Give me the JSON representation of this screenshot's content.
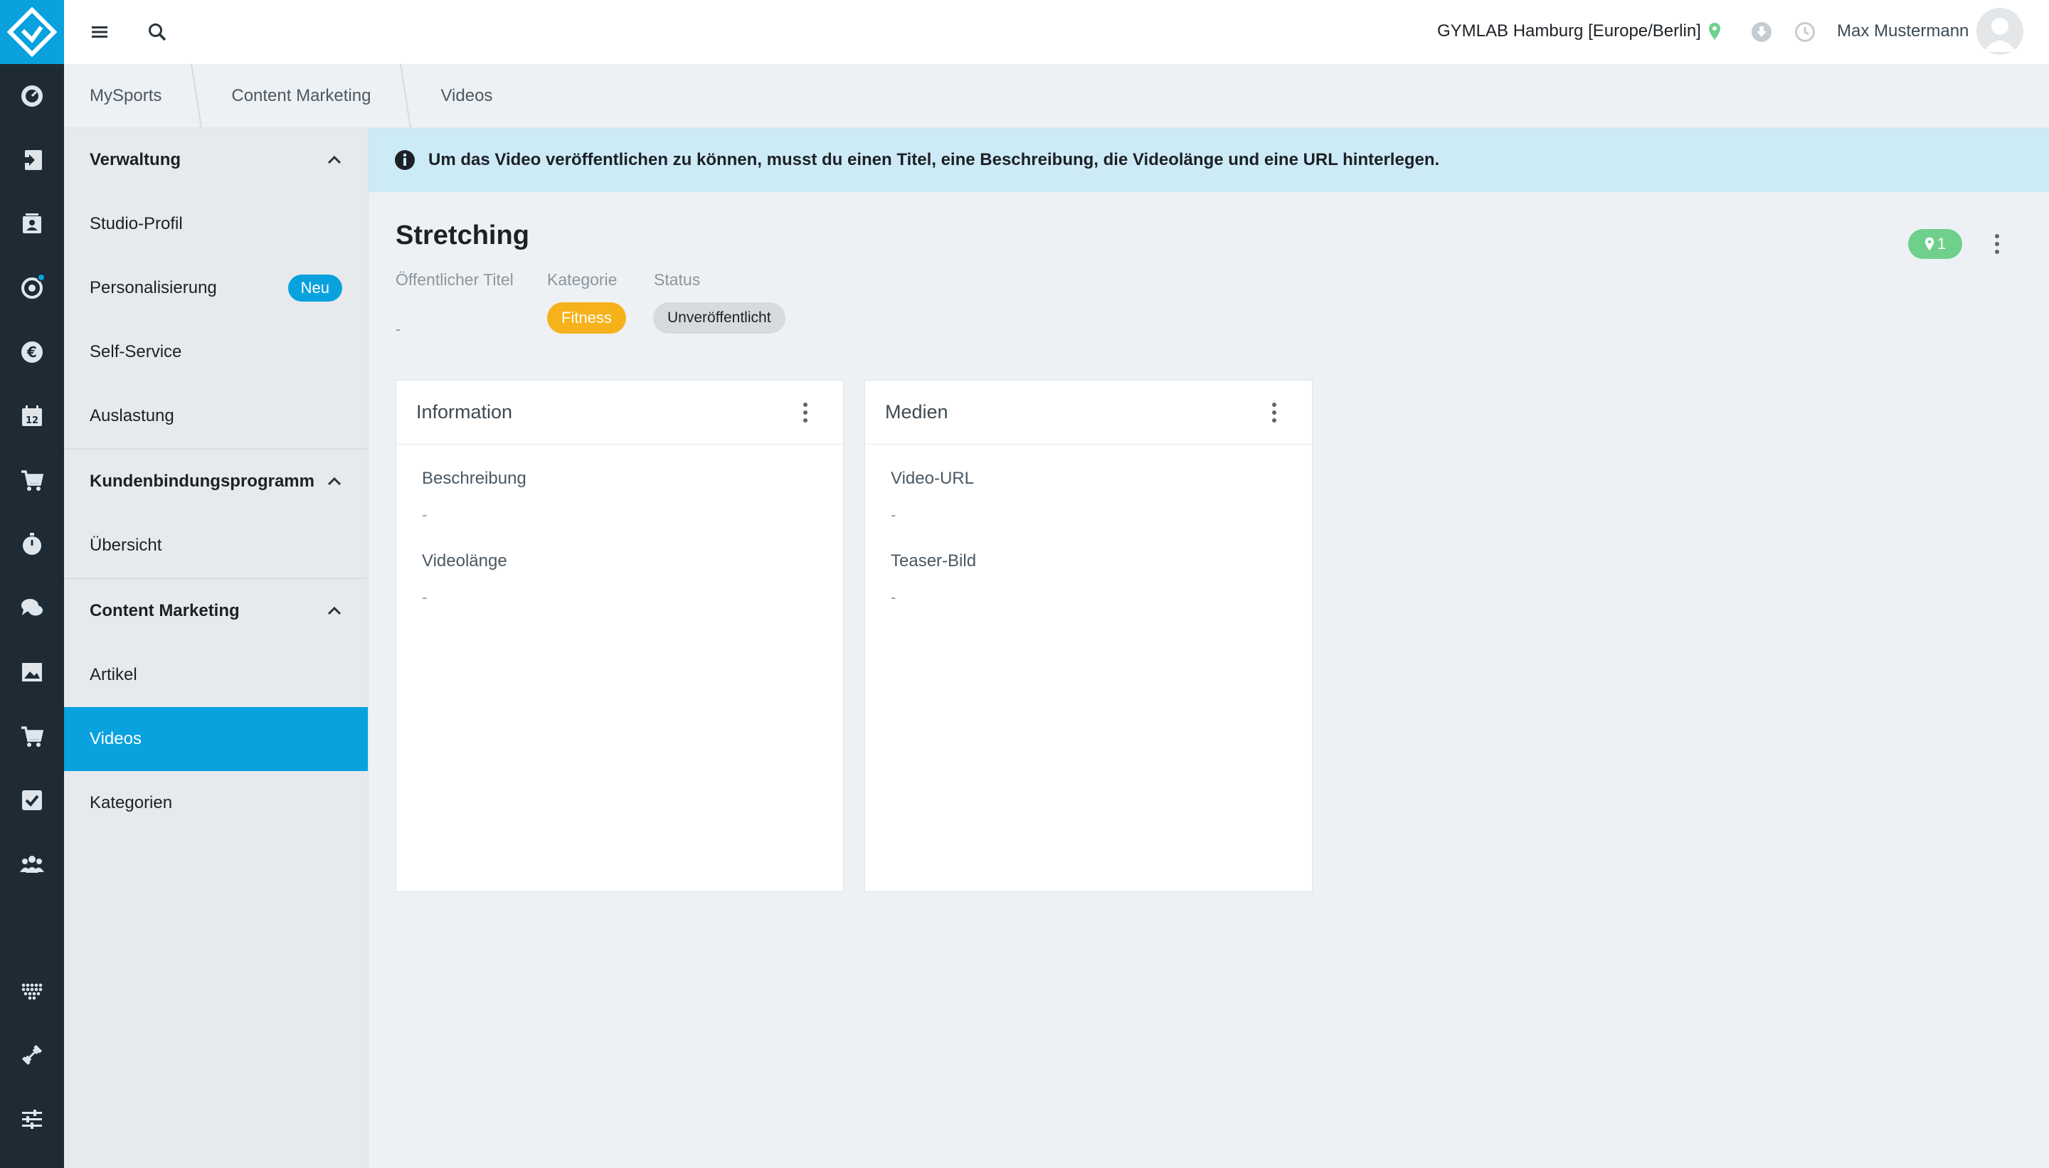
{
  "topbar": {
    "studio": "GYMLAB Hamburg [Europe/Berlin]",
    "username": "Max Mustermann"
  },
  "breadcrumb": [
    "MySports",
    "Content Marketing",
    "Videos"
  ],
  "sidenav": {
    "group_verwaltung": "Verwaltung",
    "studio_profil": "Studio-Profil",
    "personalisierung": "Personalisierung",
    "badge_neu": "Neu",
    "self_service": "Self-Service",
    "auslastung": "Auslastung",
    "group_kunden": "Kundenbindungsprogramm",
    "uebersicht": "Übersicht",
    "group_content": "Content Marketing",
    "artikel": "Artikel",
    "videos": "Videos",
    "kategorien": "Kategorien"
  },
  "info_banner": "Um das Video veröffentlichen zu können, musst du einen Titel, eine Beschreibung, die Videolänge und eine URL hinterlegen.",
  "video": {
    "title": "Stretching",
    "label_public_title": "Öffentlicher Titel",
    "public_title": "-",
    "label_category": "Kategorie",
    "category": "Fitness",
    "label_status": "Status",
    "status": "Unveröffentlicht",
    "location_count": "1"
  },
  "card_info": {
    "title": "Information",
    "label_beschreibung": "Beschreibung",
    "beschreibung": "-",
    "label_videolaenge": "Videolänge",
    "videolaenge": "-"
  },
  "card_media": {
    "title": "Medien",
    "label_url": "Video-URL",
    "url": "-",
    "label_teaser": "Teaser-Bild",
    "teaser": "-"
  },
  "colors": {
    "accent": "#0aa2de",
    "rail": "#1e2b35",
    "category_chip": "#f5b21b",
    "location_pill": "#6fd08c",
    "info_banner": "#cdeaf7"
  },
  "icons": [
    "logo-icon",
    "dashboard-icon",
    "checkin-icon",
    "contacts-icon",
    "settings-icon",
    "euro-icon",
    "calendar-icon",
    "cart-icon",
    "timer-icon",
    "chat-icon",
    "image-icon",
    "shop-icon",
    "task-icon",
    "group-icon",
    "dots-grid-icon",
    "dumbbell-icon",
    "sliders-icon"
  ]
}
